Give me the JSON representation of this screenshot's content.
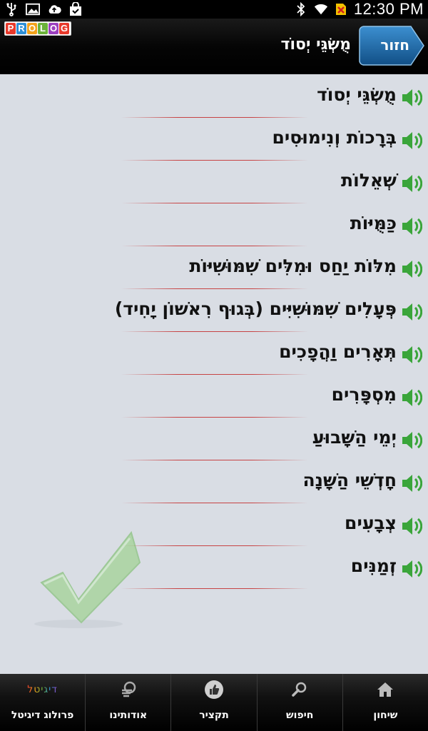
{
  "status_bar": {
    "time": "12:30 PM",
    "left_icons": [
      "usb-icon",
      "image-icon",
      "cloud-upload-icon",
      "shopping-bag-icon"
    ],
    "right_icons": [
      "bluetooth-icon",
      "wifi-icon",
      "no-sim-icon"
    ]
  },
  "header": {
    "logo_letters": [
      "P",
      "R",
      "O",
      "L",
      "O",
      "G"
    ],
    "logo_colors": [
      "#e8392b",
      "#2e8fd6",
      "#f3a21b",
      "#6bb23a",
      "#9b3fbf",
      "#e8392b"
    ],
    "title": "מֻשְׂגֵּי יְסוֹד",
    "back_label": "חזור",
    "back_color": "#1b6fb0"
  },
  "list": {
    "items": [
      "מֻשְׂגֵּי יְסוֹד",
      "בְּרָכוֹת וְנִימוּסִים",
      "שְׁאֵלוֹת",
      "כַּמֻּיּוֹת",
      "מִלּוֹת יַחַס וּמִלִּים שִׁמּוּשִׁיּוֹת",
      "פְּעָלִים שִׁמּוּשִׁיִּים (בְּגוּף רִאשׁוֹן יָחִיד)",
      "תְּאָרִים וַהֲפָכִים",
      "מִסְפָּרִים",
      "יְמֵי הַשָּׁבוּעַ",
      "חָדְשֵׁי הַשָּׁנָה",
      "צְבָעִים",
      "זְמַנִּים"
    ],
    "speaker_color": "#3aa53a"
  },
  "tabs": [
    {
      "label": "פרולוג דיגיטל",
      "icon": "digital-logo-icon",
      "icon_text": "דיגיטל"
    },
    {
      "label": "אודותינו",
      "icon": "about-icon"
    },
    {
      "label": "תקציר",
      "icon": "thumbs-up-icon"
    },
    {
      "label": "חיפוש",
      "icon": "search-icon"
    },
    {
      "label": "שיחון",
      "icon": "home-icon"
    }
  ]
}
